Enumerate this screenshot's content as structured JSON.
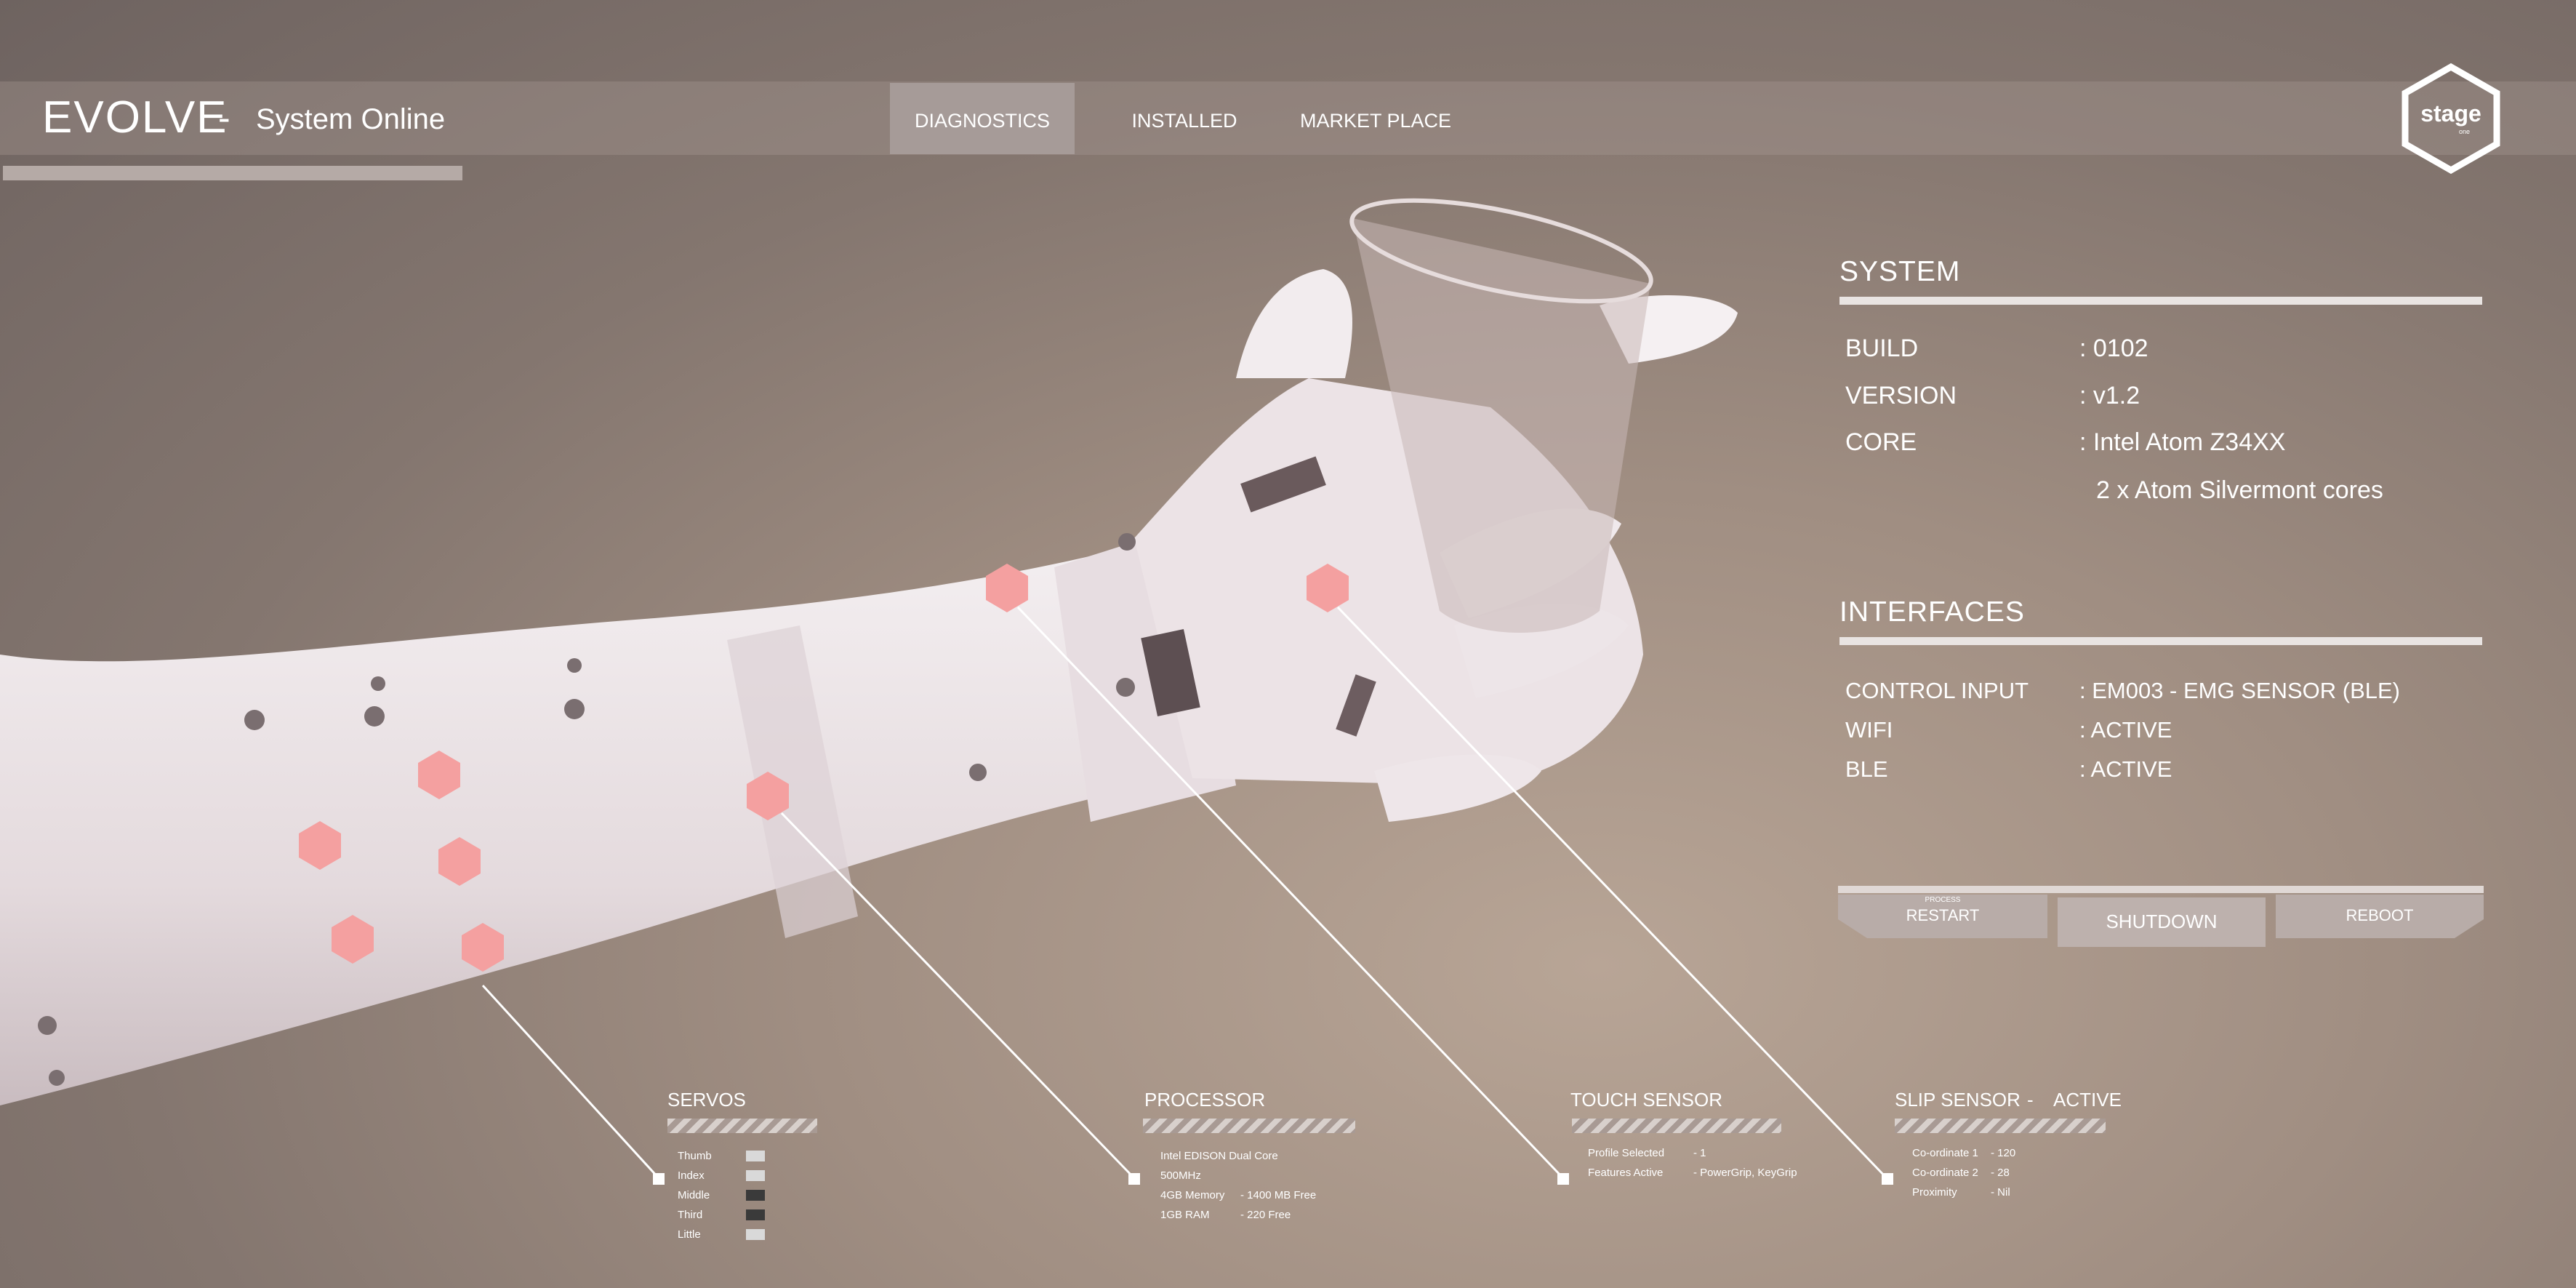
{
  "app": {
    "title": "EVOLVE",
    "separator": "-",
    "status": "System Online",
    "logo_text": "stage",
    "logo_subtext": "one"
  },
  "tabs": [
    {
      "label": "DIAGNOSTICS",
      "active": true
    },
    {
      "label": "INSTALLED",
      "active": false
    },
    {
      "label": "MARKET PLACE",
      "active": false
    }
  ],
  "system": {
    "title": "SYSTEM",
    "rows": [
      {
        "label": "BUILD",
        "value": ": 0102"
      },
      {
        "label": "VERSION",
        "value": ": v1.2"
      },
      {
        "label": "CORE",
        "value": ": Intel Atom Z34XX"
      },
      {
        "label": "",
        "value": "2 x Atom Silvermont cores"
      }
    ]
  },
  "interfaces": {
    "title": "INTERFACES",
    "rows": [
      {
        "label": "CONTROL INPUT",
        "value": ": EM003 - EMG SENSOR (BLE)"
      },
      {
        "label": "WIFI",
        "value": ": ACTIVE"
      },
      {
        "label": "BLE",
        "value": ": ACTIVE"
      }
    ]
  },
  "actions": {
    "process_caption": "PROCESS",
    "restart": "RESTART",
    "shutdown": "SHUTDOWN",
    "reboot": "REBOOT"
  },
  "callouts": {
    "servos": {
      "title": "SERVOS",
      "items": [
        {
          "label": "Thumb",
          "color": "#d9d9d9"
        },
        {
          "label": "Index",
          "color": "#d9d9d9"
        },
        {
          "label": "Middle",
          "color": "#3a3a3a"
        },
        {
          "label": "Third",
          "color": "#3a3a3a"
        },
        {
          "label": "Little",
          "color": "#d9d9d9"
        }
      ]
    },
    "processor": {
      "title": "PROCESSOR",
      "lines": [
        {
          "label": "Intel EDISON Dual Core",
          "value": ""
        },
        {
          "label": "500MHz",
          "value": ""
        },
        {
          "label": "4GB Memory",
          "value": "- 1400 MB Free"
        },
        {
          "label": "1GB RAM",
          "value": "- 220 Free"
        }
      ]
    },
    "touch": {
      "title": "TOUCH SENSOR",
      "lines": [
        {
          "label": "Profile Selected",
          "value": "- 1"
        },
        {
          "label": "Features Active",
          "value": "- PowerGrip, KeyGrip"
        }
      ]
    },
    "slip": {
      "title": "SLIP SENSOR",
      "separator": "-",
      "state": "ACTIVE",
      "lines": [
        {
          "label": "Co-ordinate 1",
          "value": "- 120"
        },
        {
          "label": "Co-ordinate 2",
          "value": "- 28"
        },
        {
          "label": "Proximity",
          "value": "- Nil"
        }
      ]
    }
  },
  "colors": {
    "hex_marker": "#f4a0a0",
    "accent_bar": "#e9e4e2"
  }
}
